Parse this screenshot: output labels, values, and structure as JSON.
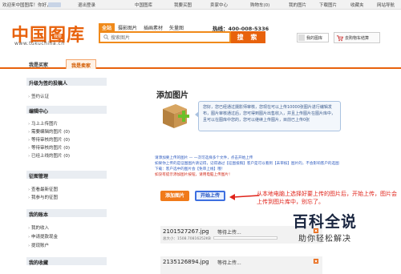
{
  "topbar": {
    "welcome": "欢迎来中国图库！你好，",
    "logout": "退出登录",
    "items": [
      "中国图库",
      "我要买图",
      "卖家中心",
      "我的图片",
      "下载图片",
      "收藏夹",
      "网站导航"
    ],
    "cart": "购物车(0)"
  },
  "logo": {
    "text": "中国图库",
    "tag": "我要",
    "url": "www.tukuchina.cn"
  },
  "search": {
    "tabs": [
      "全站",
      "摄影图片",
      "插画素材",
      "矢量图"
    ],
    "placeholder": "搜索图片",
    "button": "搜 索"
  },
  "hotline": {
    "label": "热线：",
    "number": "400-008-5336"
  },
  "user": {
    "name": "我的图库",
    "cart_label": "去购物车结算"
  },
  "nav": {
    "tabs": [
      "我是买家",
      "我是卖家"
    ],
    "active": 1
  },
  "sidebar": {
    "sections": [
      {
        "title": "升级为签约投稿人",
        "items": [
          "签约认证"
        ]
      },
      {
        "title": "编辑中心",
        "items": [
          "马上上传图片",
          "需要编辑的图片 (0)",
          "等待审核的图片 (0)",
          "等待审核的图片 (0)",
          "已经上线的图片 (0)"
        ]
      },
      {
        "title": "征图管理",
        "items": [
          "查看最新征图",
          "我参与的征图"
        ]
      },
      {
        "title": "我的账本",
        "items": [
          "我的收入",
          "申请提款现金",
          "提现账户"
        ]
      },
      {
        "title": "我的收藏",
        "items": []
      }
    ]
  },
  "main": {
    "title": "添加图片",
    "info": "您好，您已经通过摄影师审核，您现在可以上传10000张图片进行编辑发布，图片审核通过后，您可得到图片出售收入，并且上传图片在图片库中，且可以在图库中您的，您可以继续上传图片，目前已上传0张",
    "notes": [
      "请添加要上传的图片 — 一次可选择多个文件，点击开始上传",
      "如果你上传的是征图图片请记得，记得通过【征图投稿】客户是可以看到【未审核】图片的，不会影响客户的选图",
      "下载：客户选中的图片会【免审上线】哦！",
      "如没有提示添加图片按钮，请用电脑上传图片！"
    ],
    "btn_add": "添加图片",
    "btn_start": "开始上传"
  },
  "annotation": "从本地电脑上选择好要上传的图片后，开始上传，图片会上传到图片库中，别忘了。",
  "uploads": [
    {
      "name": "2101527267.jpg",
      "status": "等待上传...",
      "size": "总大小：1508.70816252KB"
    },
    {
      "name": "2135126894.jpg",
      "status": "等待上传...",
      "size": ""
    }
  ],
  "watermark": {
    "big": "百科全说",
    "small": "助你轻松解决"
  }
}
